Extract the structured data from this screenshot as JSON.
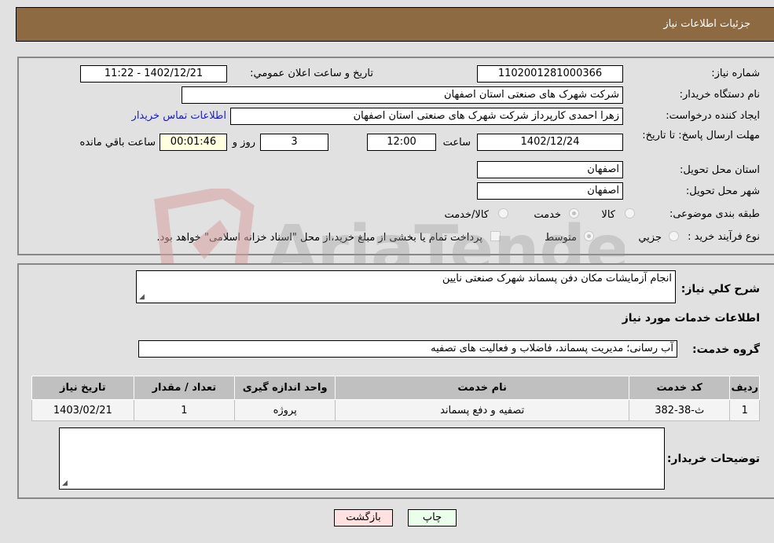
{
  "header": {
    "title": "جزئیات اطلاعات نیاز"
  },
  "form": {
    "need_number": {
      "label": "شماره نیاز:",
      "value": "1102001281000366"
    },
    "announce_datetime": {
      "label": "تاریخ و ساعت اعلان عمومي:",
      "value": "1402/12/21 - 11:22"
    },
    "buyer_org": {
      "label": "نام دستگاه خريدار:",
      "value": "شرکت شهرک های صنعتی استان اصفهان"
    },
    "requester": {
      "label": "ايجاد کننده درخواست:",
      "value": "زهرا احمدی کارپرداز شرکت شهرک های صنعتی استان اصفهان"
    },
    "buyer_contact_link": "اطلاعات تماس خريدار",
    "deadline": {
      "label": "مهلت ارسال پاسخ: تا تاريخ:",
      "date": "1402/12/24",
      "time_label": "ساعت",
      "time": "12:00",
      "days": "3",
      "days_label": "روز و",
      "remaining": "00:01:46",
      "remaining_label": "ساعت باقي مانده"
    },
    "delivery_province": {
      "label": "استان محل تحويل:",
      "value": "اصفهان"
    },
    "delivery_city": {
      "label": "شهر محل تحويل:",
      "value": "اصفهان"
    },
    "category": {
      "label": "طبقه بندی موضوعی:",
      "options": [
        "کالا",
        "خدمت",
        "کالا/خدمت"
      ],
      "selected": "خدمت"
    },
    "purchase_type": {
      "label": "نوع فرآيند خريد :",
      "options": [
        "جزيي",
        "متوسط"
      ],
      "selected": "متوسط",
      "checkbox_label": "پرداخت تمام يا بخشی از مبلغ خريد،از محل \"اسناد خزانه اسلامی\" خواهد بود."
    }
  },
  "details": {
    "description_label": "شرح کلي نياز:",
    "description": "انجام آزمایشات مکان دفن پسماند شهرک صنعتی نایین",
    "services_heading": "اطلاعات خدمات مورد نياز",
    "service_group_label": "گروه خدمت:",
    "service_group": "آب رسانی؛ مدیریت پسماند، فاضلاب و فعالیت های تصفیه",
    "table": {
      "headers": [
        "رديف",
        "کد خدمت",
        "نام خدمت",
        "واحد اندازه گيری",
        "تعداد / مقدار",
        "تاريخ نياز"
      ],
      "rows": [
        [
          "1",
          "ث-38-382",
          "تصفيه و دفع پسماند",
          "پروژه",
          "1",
          "1403/02/21"
        ]
      ]
    },
    "buyer_notes_label": "توضيحات خريدار:",
    "buyer_notes": ""
  },
  "buttons": {
    "print": "چاپ",
    "back": "بازگشت"
  },
  "watermark": {
    "text": "AriaTender.neT",
    "color": "#d9a0a0"
  }
}
